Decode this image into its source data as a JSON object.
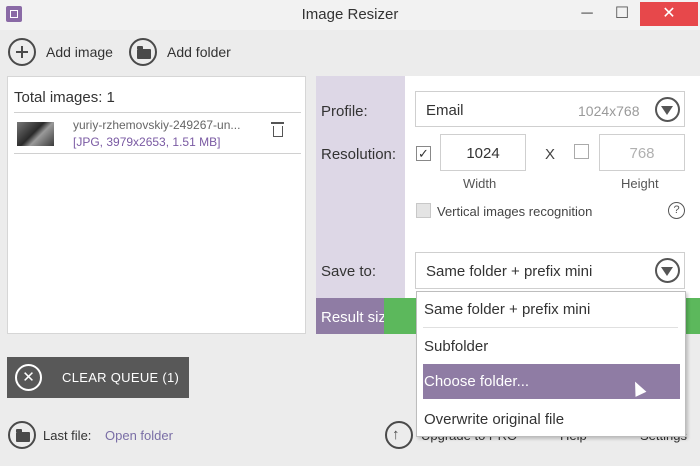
{
  "window": {
    "title": "Image Resizer",
    "minimize": "─",
    "maximize": "☐",
    "close": "✕"
  },
  "toolbar": {
    "add_image": "Add image",
    "add_folder": "Add folder"
  },
  "queue": {
    "total": "Total images: 1",
    "file_name": "yuriy-rzhemovskiy-249267-un...",
    "file_meta": "[JPG, 3979x2653, 1.51 MB]",
    "clear_label": "CLEAR QUEUE (1)"
  },
  "settings": {
    "profile_label": "Profile:",
    "profile_value": "Email",
    "profile_size": "1024x768",
    "resolution_label": "Resolution:",
    "width_value": "1024",
    "height_value": "768",
    "separator": "X",
    "width_label": "Width",
    "height_label": "Height",
    "vertical_recognition": "Vertical images recognition",
    "help": "?",
    "save_to_label": "Save to:",
    "save_to_value": "Same folder + prefix mini",
    "result_size_label": "Result size:",
    "width_checked": "✓"
  },
  "save_options": [
    "Same folder + prefix mini",
    "Subfolder",
    "Choose folder...",
    "Overwrite original file"
  ],
  "bottom": {
    "last_file_label": "Last file:",
    "open_folder": "Open folder",
    "upgrade": "Upgrade to PRO",
    "help": "Help",
    "settings": "Settings"
  },
  "colors": {
    "accent": "#8f7ca4",
    "close": "#e7484b",
    "go": "#5cb85c"
  }
}
